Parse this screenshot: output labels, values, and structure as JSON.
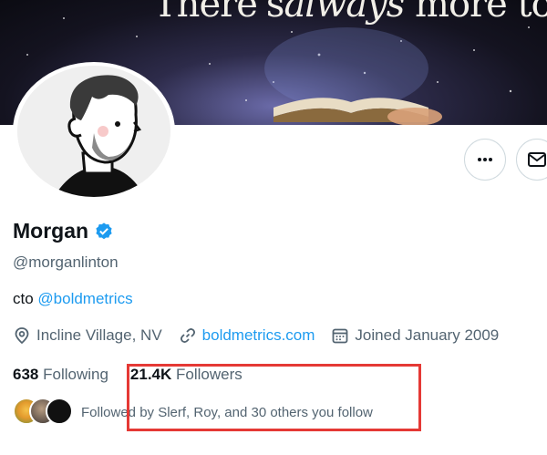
{
  "banner": {
    "text_before": "There's",
    "text_italic": "always",
    "text_after": " more to learn"
  },
  "profile": {
    "name": "Morgan",
    "handle": "@morganlinton",
    "bio_prefix": "cto ",
    "bio_link": "@boldmetrics",
    "location": "Incline Village, NV",
    "website": "boldmetrics.com",
    "joined": "Joined January 2009"
  },
  "stats": {
    "following_count": "638",
    "following_label": "Following",
    "followers_count": "21.4K",
    "followers_label": "Followers"
  },
  "followed_by": "Followed by Slerf, Roy, and 30 others you follow",
  "icons": [
    "more-icon",
    "mail-icon",
    "verified-icon",
    "location-icon",
    "link-icon",
    "calendar-icon"
  ],
  "colors": {
    "accent": "#1d9bf0",
    "secondary_text": "#536471",
    "highlight_box": "#e53935"
  }
}
